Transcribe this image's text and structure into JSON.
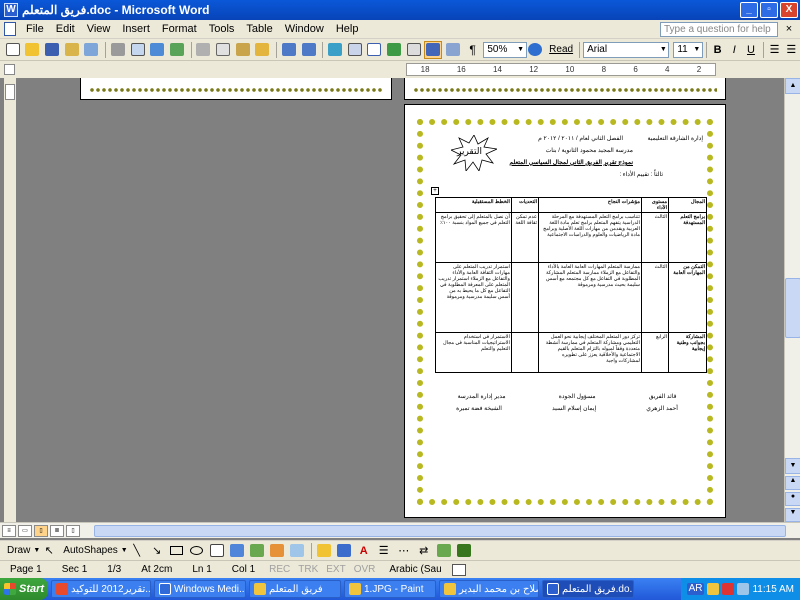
{
  "window": {
    "title": "فريق المتعلم.doc - Microsoft Word",
    "app_icon": "W",
    "min": "_",
    "max": "▫",
    "close": "X"
  },
  "menu": {
    "items": [
      "File",
      "Edit",
      "View",
      "Insert",
      "Format",
      "Tools",
      "Table",
      "Window",
      "Help"
    ],
    "help_placeholder": "Type a question for help",
    "close": "×"
  },
  "toolbar": {
    "zoom": "50%",
    "read_label": "Read",
    "font": "Arial",
    "size": "11",
    "bold": "B",
    "italic": "I",
    "underline": "U"
  },
  "ruler": {
    "ticks": [
      "18",
      "16",
      "14",
      "12",
      "10",
      "8",
      "6",
      "4",
      "2"
    ]
  },
  "document": {
    "burst_label": "التقرير",
    "header_right": "إدارة الشارقة التعليمية",
    "header_center": "الفصل الثاني لعام / ٢٠١١ / ٢٠١٢ م",
    "school": "مدرسة المجيد محمود الثانوية / بنات",
    "form_title": "نموذج تقرير الفريق الثاني لمجال السياسي المتعلم",
    "team_label": "ثالثاً : تقييم الأداء :",
    "table_handle": "+",
    "col_headers": [
      "المجال",
      "مستوى الأداء",
      "مؤشرات النجاح",
      "التحديات",
      "الخطط المستقبلية"
    ],
    "rows": [
      {
        "domain": "برامج التعلم المستهدفة",
        "level": "الثالث",
        "indicators": "تتناسب برامج التعلم المستهدفة مع المرحلة الدراسية يتفهم المتعلم برامج تعلم مادة اللغة العربية ويقدمن من مهارات اللغة الأصلية وبرامج مادة الرياضيات والعلوم والدراسات الاجتماعية",
        "challenges": "عدم تمكن ثقافة اللغة",
        "plans": "أن نصل بالمتعلم إلى تحقيق برامج التعلم في جميع المواد بنسبة ١٠٠٪"
      },
      {
        "domain": "التمكن من المهارات العامة",
        "level": "الثالث",
        "indicators": "ممارسة المتعلم المهارات العامة العامة بالأداء والتفاعل مع الزملاء ممارسة المتعلم المشاركة المطلوبة في التفاعل مع كل مجتمعه مع أسس سليمة بحيث مدرسية ومرموقة",
        "challenges": "",
        "plans": "استمرار تدريب المتعلم على مهارات الثقافة العامة والأداء والتفاعل مع الزملاء استمرار تدريب المتعلم على المعرفة المطلوبة في التفاعل مع كل ما يحيط به من أسس سليمة مدرسية ومرموقة"
      },
      {
        "domain": "المشاركة بجوانب وطنية إيجابية",
        "level": "الرابع",
        "indicators": "تركز دور المتعلم المختلف إيجابية نحو العمل التعليمي ومشاركة المتعلم في ممارسة أنشطة متعددة وفقاً لميوله بالتزام المتعلم بالقيم الاجتماعية والأخلاقية يعزز على تطويره لمشاركات واجبة",
        "challenges": "",
        "plans": "الاستمرار في استخدام الاستراتيجيات المناسبة في مجال التعليم والتعلم"
      }
    ],
    "signatures_titles": [
      "قائد الفريق",
      "مسؤول الجودة",
      "مدير إدارة المدرسة"
    ],
    "signatures_names": [
      "أحمد الزهري",
      "إيمان إسلام السيد",
      "الشيخة فضة تميرة"
    ]
  },
  "drawbar": {
    "draw": "Draw",
    "autoshapes": "AutoShapes"
  },
  "status": {
    "page": "Page 1",
    "sec": "Sec 1",
    "pages": "1/3",
    "at": "At 2cm",
    "ln": "Ln 1",
    "col": "Col 1",
    "rec": "REC",
    "trk": "TRK",
    "ext": "EXT",
    "ovr": "OVR",
    "lang": "Arabic (Sau"
  },
  "taskbar": {
    "start": "Start",
    "tasks": [
      {
        "label": "تقرير2012 للتوكيد...",
        "color": "#e84a2b"
      },
      {
        "label": "Windows Medi...",
        "color": "#2f6ad8"
      },
      {
        "label": "فريق المتعلم",
        "color": "#f0c43c"
      },
      {
        "label": "1.JPG - Paint",
        "color": "#f0c43c"
      },
      {
        "label": "صلاح بن محمد البدير",
        "color": "#f0c43c"
      },
      {
        "label": "فريق المتعلم.do...",
        "color": "#2b5fcf",
        "active": true
      }
    ],
    "tray_lang": "AR",
    "time": "11:15 AM"
  },
  "colors": {
    "title_bar": "#0a58d8",
    "page_border_stars": "#b8b820",
    "taskbar": "#2158d8"
  }
}
